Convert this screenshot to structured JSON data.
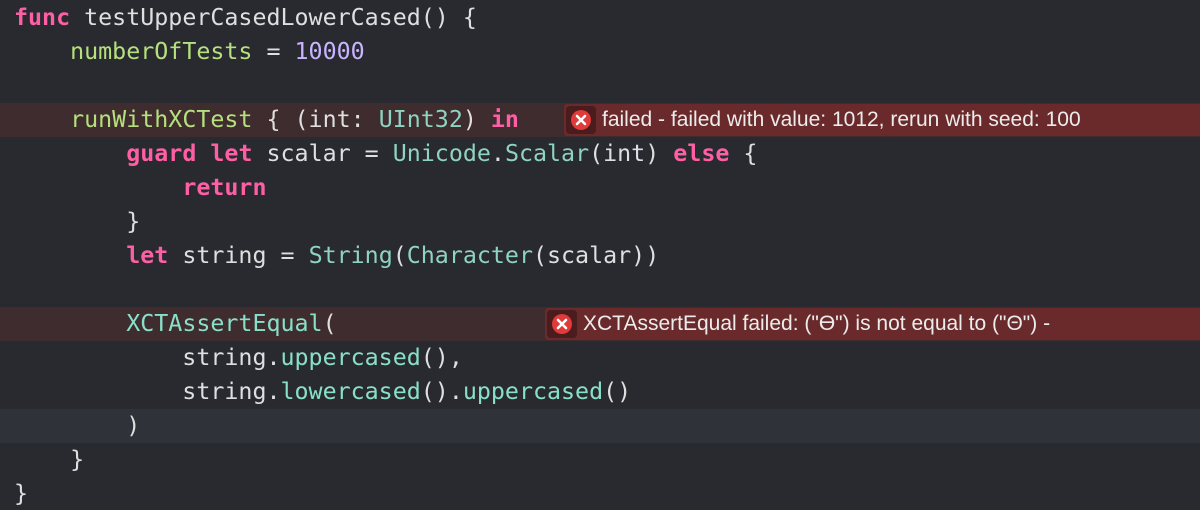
{
  "editor": {
    "lines": [
      {
        "tokens": [
          [
            "kw",
            "func"
          ],
          [
            "pl",
            " testUpperCasedLowerCased() {"
          ]
        ]
      },
      {
        "tokens": [
          [
            "pl",
            "    "
          ],
          [
            "prop",
            "numberOfTests"
          ],
          [
            "pl",
            " = "
          ],
          [
            "num2",
            "10000"
          ]
        ]
      },
      {
        "tokens": []
      },
      {
        "tokens": [
          [
            "pl",
            "    "
          ],
          [
            "prop",
            "runWithXCTest"
          ],
          [
            "pl",
            " { (int: "
          ],
          [
            "ty2",
            "UInt32"
          ],
          [
            "pl",
            ") "
          ],
          [
            "kw",
            "in"
          ]
        ]
      },
      {
        "tokens": [
          [
            "pl",
            "        "
          ],
          [
            "kw",
            "guard"
          ],
          [
            "pl",
            " "
          ],
          [
            "kw",
            "let"
          ],
          [
            "pl",
            " scalar = "
          ],
          [
            "ty2",
            "Unicode"
          ],
          [
            "pl",
            "."
          ],
          [
            "ty2",
            "Scalar"
          ],
          [
            "pl",
            "(int) "
          ],
          [
            "kw",
            "else"
          ],
          [
            "pl",
            " {"
          ]
        ]
      },
      {
        "tokens": [
          [
            "pl",
            "            "
          ],
          [
            "kw",
            "return"
          ]
        ]
      },
      {
        "tokens": [
          [
            "pl",
            "        }"
          ]
        ]
      },
      {
        "tokens": [
          [
            "pl",
            "        "
          ],
          [
            "kw",
            "let"
          ],
          [
            "pl",
            " string = "
          ],
          [
            "ty2",
            "String"
          ],
          [
            "pl",
            "("
          ],
          [
            "ty2",
            "Character"
          ],
          [
            "pl",
            "(scalar))"
          ]
        ]
      },
      {
        "tokens": []
      },
      {
        "tokens": [
          [
            "pl",
            "        "
          ],
          [
            "fn",
            "XCTAssertEqual"
          ],
          [
            "pl",
            "("
          ]
        ]
      },
      {
        "tokens": [
          [
            "pl",
            "            string."
          ],
          [
            "fn",
            "uppercased"
          ],
          [
            "pl",
            "(),"
          ]
        ]
      },
      {
        "tokens": [
          [
            "pl",
            "            string."
          ],
          [
            "fn",
            "lowercased"
          ],
          [
            "pl",
            "()."
          ],
          [
            "fn",
            "uppercased"
          ],
          [
            "pl",
            "()"
          ]
        ]
      },
      {
        "tokens": [
          [
            "pl",
            "        )"
          ]
        ]
      },
      {
        "tokens": [
          [
            "pl",
            "    }"
          ]
        ]
      },
      {
        "tokens": [
          [
            "pl",
            "}"
          ]
        ]
      }
    ],
    "error_lines": [
      3,
      9
    ],
    "current_line": 12
  },
  "annotations": [
    {
      "line": 3,
      "message": "failed - failed with value: 1012, rerun with seed: 100"
    },
    {
      "line": 9,
      "message": "XCTAssertEqual failed: (\"ϴ\") is not equal to (\"Θ\") -"
    }
  ],
  "colors": {
    "background": "#292a30",
    "keyword": "#fc5fa3",
    "property": "#b5e07d",
    "function": "#89e0c9",
    "type": "#8fd3c3",
    "number": "#c8b4ff",
    "plain": "#dfdfe0",
    "error_line_bg": "#3e2c2e",
    "error_banner_bg": "#6a2a2b",
    "error_icon": "#e03a3a"
  },
  "icons": {
    "error": "error-x-icon"
  }
}
